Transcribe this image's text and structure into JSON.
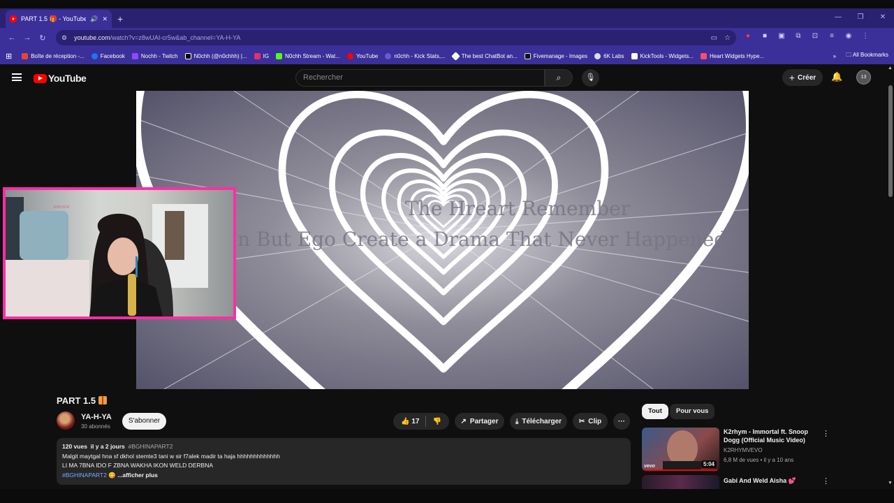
{
  "browser": {
    "tab_title": "PART 1.5 🎁 - YouTube",
    "new_tab": "+",
    "url_host": "youtube.com",
    "url_path": "/watch?v=z8wUAI-cr5w&ab_channel=YA-H-YA",
    "bookmarks": [
      {
        "label": "Boîte de réception -...",
        "color": "#ea4335"
      },
      {
        "label": "Facebook",
        "color": "#1877f2"
      },
      {
        "label": "Nochh - Twitch",
        "color": "#9146ff"
      },
      {
        "label": "N0chh (@n0chhh) |...",
        "color": "#000000"
      },
      {
        "label": "IG",
        "color": "#e1306c"
      },
      {
        "label": "N0chh Stream - Wat...",
        "color": "#53fc18"
      },
      {
        "label": "YouTube",
        "color": "#ff0000"
      },
      {
        "label": "n0chh - Kick Stats,...",
        "color": "#6a5acd"
      },
      {
        "label": "The best ChatBot an...",
        "color": "#ffffff"
      },
      {
        "label": "Fivemanage - Images",
        "color": "#111111"
      },
      {
        "label": "6K Labs",
        "color": "#dddddd"
      },
      {
        "label": "KickTools - Widgets...",
        "color": "#ffffff"
      },
      {
        "label": "Heart Widgets Hype...",
        "color": "#ff4d6d"
      }
    ],
    "bookmarks_more": "»",
    "all_bookmarks": "All Bookmarks"
  },
  "youtube": {
    "logo_text": "YouTube",
    "search_placeholder": "Rechercher",
    "create_label": "Créer",
    "avatar_label": "13"
  },
  "video": {
    "overlay_line1": "The Hreart Remember",
    "overlay_line2": "n But Ego Create a Drama That Never Happened",
    "cam_watermark": "SHPUSTA"
  },
  "watch": {
    "title": "PART 1.5",
    "channel_name": "YA-H-YA",
    "subscribers": "30 abonnés",
    "subscribe_label": "S'abonner",
    "likes": "17",
    "share_label": "Partager",
    "download_label": "Télécharger",
    "clip_label": "Clip",
    "more_label": "···",
    "desc_views": "120 vues",
    "desc_date": "il y a 2 jours",
    "desc_hashtag": "#BGHINAPART2",
    "desc_line1": "Malgit maytgal hna sf dkhol stemte3 tani w sir f7alek madir ta haja hhhhhhhhhhhhh",
    "desc_line2": "LI MA 7BNA IDO F ZBNA WAKHA IKON WELD DERBNA",
    "desc_tag2": "#BGHINAPART2",
    "desc_emoji": "😋",
    "desc_more": "...afficher plus"
  },
  "sidebar": {
    "chips": [
      "Tout",
      "Pour vous"
    ],
    "recs": [
      {
        "title": "K2rhym - Immortal ft. Snoop Dogg (Official Music Video)",
        "channel": "K2RHYMVEVO",
        "meta": "6,8 M de vues • il y a 10 ans",
        "duration": "5:04",
        "badge": "vevo"
      },
      {
        "title": "Gabi And Weld Aisha 💕",
        "channel": "",
        "meta": "",
        "duration": "",
        "badge": ""
      }
    ]
  }
}
